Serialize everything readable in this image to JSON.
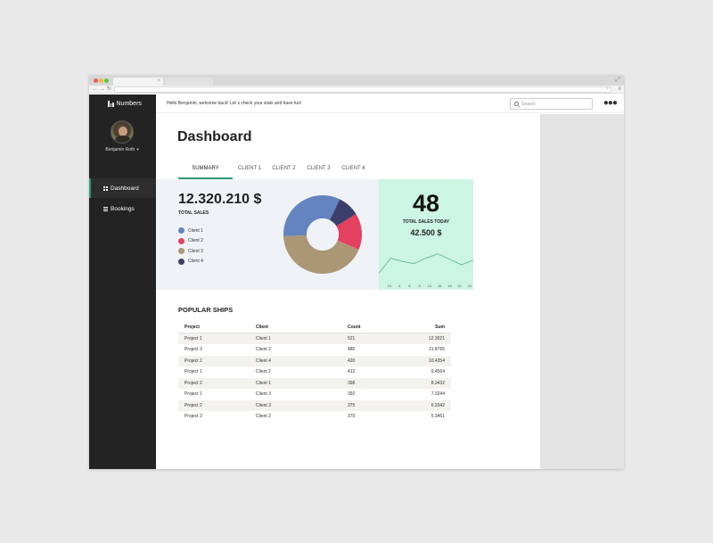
{
  "app": {
    "brand": "Numbers",
    "brand_icon": "bar-chart-icon"
  },
  "user": {
    "name": "Benjamin Roth"
  },
  "sidebar": {
    "items": [
      {
        "label": "Dashboard",
        "icon": "grid-icon",
        "active": true
      },
      {
        "label": "Bookings",
        "icon": "list-icon",
        "active": false
      }
    ]
  },
  "topbar": {
    "welcome": "Hello Benjamin, welcome back! Let´s check your stats and have fun!",
    "search_placeholder": "Search",
    "more_icon": "more-dots-icon"
  },
  "main": {
    "title": "Dashboard",
    "tabs": [
      {
        "label": "SUMMARY",
        "active": true
      },
      {
        "label": "CLIENT 1",
        "active": false
      },
      {
        "label": "CLIENT 2",
        "active": false
      },
      {
        "label": "CLIENT 3",
        "active": false
      },
      {
        "label": "CLIENT 4",
        "active": false
      }
    ]
  },
  "summary": {
    "total": "12.320.210 $",
    "total_label": "TOTAL SALES",
    "legend": [
      {
        "label": "Client 1",
        "color": "#6384bf"
      },
      {
        "label": "Client 2",
        "color": "#e4405f"
      },
      {
        "label": "Client 3",
        "color": "#ab9675"
      },
      {
        "label": "Client 4",
        "color": "#3c3f6a"
      }
    ]
  },
  "today": {
    "count": "48",
    "label": "TOTAL SALES TODAY",
    "amount": "42.500 $"
  },
  "popular_ships": {
    "title": "POPULAR SHIPS",
    "columns": [
      "Project",
      "Client",
      "Count",
      "Sum"
    ],
    "rows": [
      [
        "Project 1",
        "Client 1",
        "521",
        "12.3021"
      ],
      [
        "Project 3",
        "Client 2",
        "480",
        "11.8765"
      ],
      [
        "Project 2",
        "Client 4",
        "420",
        "10.4354"
      ],
      [
        "Project 1",
        "Client 2",
        "412",
        "9.4564"
      ],
      [
        "Project 2",
        "Client 1",
        "398",
        "8.3432"
      ],
      [
        "Project 1",
        "Client 3",
        "392",
        "7.3244"
      ],
      [
        "Project 2",
        "Client 3",
        "375",
        "6.3342"
      ],
      [
        "Project 3",
        "Client 2",
        "370",
        "5.3461"
      ]
    ]
  },
  "chart_data": [
    {
      "type": "pie",
      "donut": true,
      "categories": [
        "Client 1",
        "Client 4",
        "Client 2",
        "Client 3"
      ],
      "values": [
        33,
        9,
        15,
        43
      ],
      "colors": [
        "#6384bf",
        "#3c3f6a",
        "#e4405f",
        "#ab9675"
      ]
    },
    {
      "type": "line",
      "x": [
        "24",
        "4",
        "6",
        "9",
        "12",
        "15",
        "18",
        "21",
        "24"
      ],
      "y": [
        1,
        8,
        6.5,
        5.5,
        8,
        10,
        7.5,
        5,
        7
      ],
      "ylim": [
        0,
        14
      ],
      "color": "#6fbf98"
    }
  ]
}
